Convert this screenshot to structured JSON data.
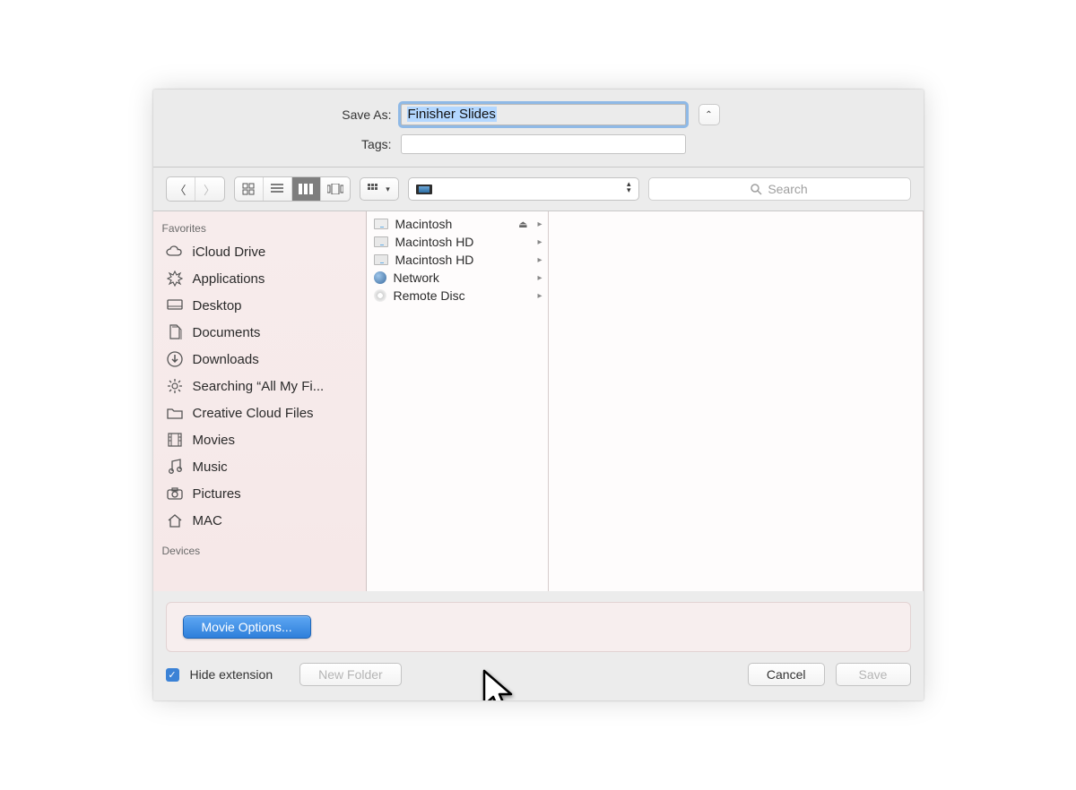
{
  "form": {
    "saveAsLabel": "Save As:",
    "saveAsValue": "Finisher Slides",
    "tagsLabel": "Tags:"
  },
  "toolbar": {
    "backTip": "Back",
    "fwdTip": "Forward",
    "viewIcon": "Icon view",
    "viewList": "List view",
    "viewColumn": "Column view",
    "viewCover": "Cover flow",
    "arrangeTip": "Arrange",
    "locationLabel": "",
    "searchPlaceholder": "Search"
  },
  "sidebar": {
    "favoritesHeader": "Favorites",
    "devicesHeader": "Devices",
    "items": [
      {
        "label": "iCloud Drive",
        "icon": "cloud"
      },
      {
        "label": "Applications",
        "icon": "apps"
      },
      {
        "label": "Desktop",
        "icon": "desktop"
      },
      {
        "label": "Documents",
        "icon": "documents"
      },
      {
        "label": "Downloads",
        "icon": "downloads"
      },
      {
        "label": "Searching “All My Fi...",
        "icon": "gear"
      },
      {
        "label": "Creative Cloud Files",
        "icon": "folder"
      },
      {
        "label": "Movies",
        "icon": "movies"
      },
      {
        "label": "Music",
        "icon": "music"
      },
      {
        "label": "Pictures",
        "icon": "pictures"
      },
      {
        "label": "MAC",
        "icon": "home"
      }
    ]
  },
  "column": {
    "items": [
      {
        "label": "Macintosh",
        "icon": "drive-ext",
        "eject": true
      },
      {
        "label": "Macintosh HD",
        "icon": "drive"
      },
      {
        "label": "Macintosh HD",
        "icon": "drive"
      },
      {
        "label": "Network",
        "icon": "globe"
      },
      {
        "label": "Remote Disc",
        "icon": "disc"
      }
    ]
  },
  "options": {
    "movieOptionsLabel": "Movie Options..."
  },
  "footer": {
    "hideExtLabel": "Hide extension",
    "newFolderLabel": "New Folder",
    "cancelLabel": "Cancel",
    "saveLabel": "Save"
  }
}
